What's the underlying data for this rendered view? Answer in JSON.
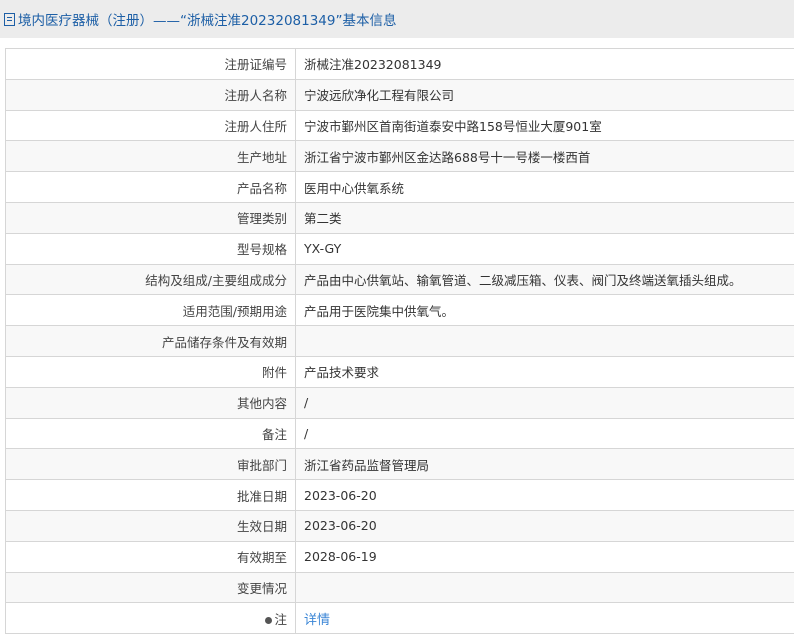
{
  "header": {
    "title": "境内医疗器械（注册）——“浙械注准20232081349”基本信息",
    "icon": "document-icon"
  },
  "rows": [
    {
      "label": "注册证编号",
      "value": "浙械注准20232081349"
    },
    {
      "label": "注册人名称",
      "value": "宁波远欣净化工程有限公司"
    },
    {
      "label": "注册人住所",
      "value": "宁波市鄞州区首南街道泰安中路158号恒业大厦901室"
    },
    {
      "label": "生产地址",
      "value": "浙江省宁波市鄞州区金达路688号十一号楼一楼西首"
    },
    {
      "label": "产品名称",
      "value": "医用中心供氧系统"
    },
    {
      "label": "管理类别",
      "value": "第二类"
    },
    {
      "label": "型号规格",
      "value": "YX-GY"
    },
    {
      "label": "结构及组成/主要组成成分",
      "value": "产品由中心供氧站、输氧管道、二级减压箱、仪表、阀门及终端送氧插头组成。"
    },
    {
      "label": "适用范围/预期用途",
      "value": "产品用于医院集中供氧气。"
    },
    {
      "label": "产品储存条件及有效期",
      "value": ""
    },
    {
      "label": "附件",
      "value": "产品技术要求"
    },
    {
      "label": "其他内容",
      "value": "/"
    },
    {
      "label": "备注",
      "value": "/"
    },
    {
      "label": "审批部门",
      "value": "浙江省药品监督管理局"
    },
    {
      "label": "批准日期",
      "value": "2023-06-20"
    },
    {
      "label": "生效日期",
      "value": "2023-06-20"
    },
    {
      "label": "有效期至",
      "value": "2028-06-19"
    },
    {
      "label": "变更情况",
      "value": ""
    }
  ],
  "note": {
    "label": "注",
    "link": "详情",
    "icon": "lightbulb-icon"
  }
}
